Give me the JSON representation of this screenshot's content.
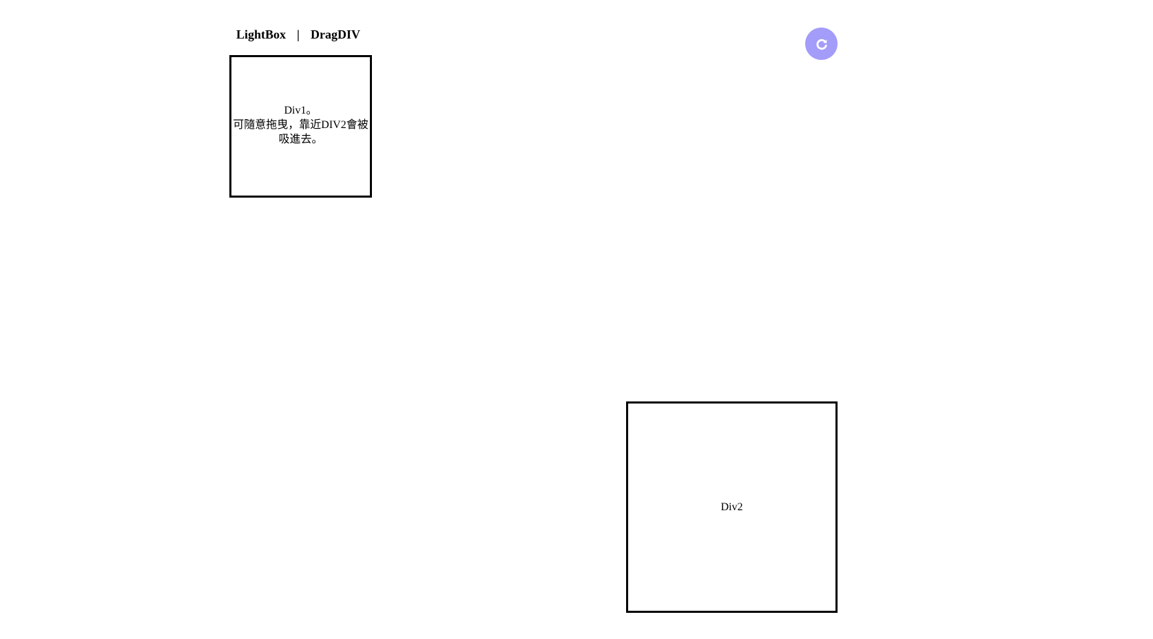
{
  "nav": {
    "lightbox_label": "LightBox",
    "separator": "|",
    "dragdiv_label": "DragDIV"
  },
  "reset_button": {
    "icon": "refresh-icon",
    "color": "#a49cf9"
  },
  "div1": {
    "line1": "Div1。",
    "line2": "可隨意拖曳，靠近DIV2會被",
    "line3": "吸進去。"
  },
  "div2": {
    "label": "Div2"
  }
}
